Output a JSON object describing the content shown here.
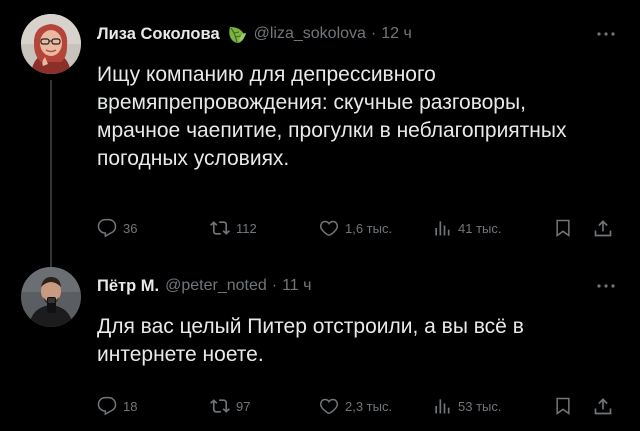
{
  "tweets": [
    {
      "display_name": "Лиза Соколова",
      "verified_badge": "leaf-badge-icon",
      "handle": "@liza_sokolova",
      "separator": "·",
      "time": "12 ч",
      "text": "Ищу компанию для депрессивного\nвремяпрепровождения: скучные разговоры,\nмрачное чаепитие, прогулки в неблагоприятных\nпогодных условиях.",
      "stats": {
        "replies": "36",
        "retweets": "112",
        "likes": "1,6 тыс.",
        "views": "41 тыс."
      }
    },
    {
      "display_name": "Пётр М.",
      "handle": "@peter_noted",
      "separator": "·",
      "time": "11 ч",
      "text": "Для вас целый Питер отстроили, а вы всё в\nинтернете ноете.",
      "stats": {
        "replies": "18",
        "retweets": "97",
        "likes": "2,3 тыс.",
        "views": "53 тыс."
      }
    }
  ],
  "colors": {
    "background": "#000000",
    "primary_text": "#e7e9ea",
    "secondary_text": "#71767b",
    "thread_line": "#333639",
    "badge_green": "#7cb342"
  }
}
